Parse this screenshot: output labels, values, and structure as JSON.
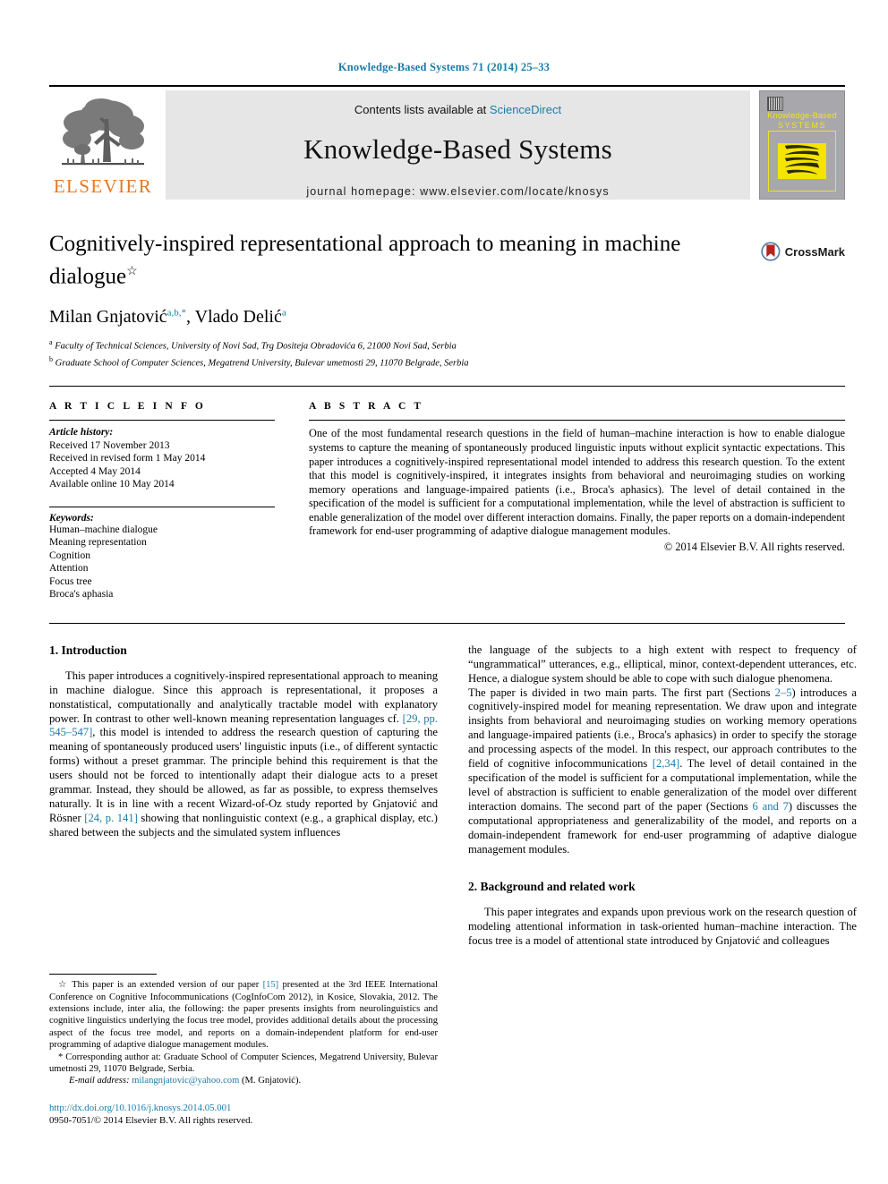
{
  "running_head": "Knowledge-Based Systems 71 (2014) 25–33",
  "masthead": {
    "contents_prefix": "Contents lists available at ",
    "sciencedirect": "ScienceDirect",
    "journal_name": "Knowledge-Based Systems",
    "homepage": "journal homepage: www.elsevier.com/locate/knosys",
    "publisher_wordmark": "ELSEVIER",
    "cover_title_line1": "Knowledge-Based",
    "cover_title_line2": "SYSTEMS",
    "accent_blue": "#1a7ba8",
    "elsevier_orange": "#E87722",
    "cover_yellow": "#f2e31a"
  },
  "article": {
    "title": "Cognitively-inspired representational approach to meaning in machine dialogue",
    "title_marker": "☆",
    "authors": "Milan Gnjatović, Vlado Delić",
    "author1_name": "Milan Gnjatović",
    "author1_sup": "a,b,*",
    "author2_name": "Vlado Delić",
    "author2_sup": "a",
    "affiliation_a": "Faculty of Technical Sciences, University of Novi Sad, Trg Dositeja Obradovića 6, 21000 Novi Sad, Serbia",
    "affiliation_b": "Graduate School of Computer Sciences, Megatrend University, Bulevar umetnosti 29, 11070 Belgrade, Serbia",
    "crossmark_label": "CrossMark"
  },
  "article_info": {
    "heading": "A R T I C L E  I N F O",
    "history_label": "Article history:",
    "history": [
      "Received 17 November 2013",
      "Received in revised form 1 May 2014",
      "Accepted 4 May 2014",
      "Available online 10 May 2014"
    ],
    "keywords_label": "Keywords:",
    "keywords": [
      "Human–machine dialogue",
      "Meaning representation",
      "Cognition",
      "Attention",
      "Focus tree",
      "Broca's aphasia"
    ]
  },
  "abstract": {
    "heading": "A B S T R A C T",
    "text": "One of the most fundamental research questions in the field of human–machine interaction is how to enable dialogue systems to capture the meaning of spontaneously produced linguistic inputs without explicit syntactic expectations. This paper introduces a cognitively-inspired representational model intended to address this research question. To the extent that this model is cognitively-inspired, it integrates insights from behavioral and neuroimaging studies on working memory operations and language-impaired patients (i.e., Broca's aphasics). The level of detail contained in the specification of the model is sufficient for a computational implementation, while the level of abstraction is sufficient to enable generalization of the model over different interaction domains. Finally, the paper reports on a domain-independent framework for end-user programming of adaptive dialogue management modules.",
    "copyright": "© 2014 Elsevier B.V. All rights reserved."
  },
  "body": {
    "section1_heading": "1. Introduction",
    "section1_p1_a": "This paper introduces a cognitively-inspired representational approach to meaning in machine dialogue. Since this approach is representational, it proposes a nonstatistical, computationally and analytically tractable model with explanatory power. In contrast to other well-known meaning representation languages cf. ",
    "section1_p1_ref1": "[29, pp. 545–547]",
    "section1_p1_b": ", this model is intended to address the research question of capturing the meaning of spontaneously produced users' linguistic inputs (i.e., of different syntactic forms) without a preset grammar. The principle behind this requirement is that the users should not be forced to intentionally adapt their dialogue acts to a preset grammar. Instead, they should be allowed, as far as possible, to express themselves naturally. It is in line with a recent Wizard-of-Oz study reported by Gnjatović and Rösner ",
    "section1_p1_ref2": "[24, p. 141]",
    "section1_p1_c": " showing that nonlinguistic context (e.g., a graphical display, etc.) shared between the subjects and the simulated system influences the language of the subjects to a high extent with respect to frequency of “ungrammatical” utterances, e.g., elliptical, minor, context-dependent utterances, etc. Hence, a dialogue system should be able to cope with such dialogue phenomena.",
    "section1_p2_a": "The paper is divided in two main parts. The first part (Sections ",
    "section1_p2_ref1": "2–5",
    "section1_p2_b": ") introduces a cognitively-inspired model for meaning representation. We draw upon and integrate insights from behavioral and neuroimaging studies on working memory operations and language-impaired patients (i.e., Broca's aphasics) in order to specify the storage and processing aspects of the model. In this respect, our approach contributes to the field of cognitive infocommunications ",
    "section1_p2_ref2": "[2,34]",
    "section1_p2_c": ". The level of detail contained in the specification of the model is sufficient for a computational implementation, while the level of abstraction is sufficient to enable generalization of the model over different interaction domains. The second part of the paper (Sections ",
    "section1_p2_ref3": "6 and 7",
    "section1_p2_d": ") discusses the computational appropriateness and generalizability of the model, and reports on a domain-independent framework for end-user programming of adaptive dialogue management modules.",
    "section2_heading": "2. Background and related work",
    "section2_p1": "This paper integrates and expands upon previous work on the research question of modeling attentional information in task-oriented human–machine interaction. The focus tree is a model of attentional state introduced by Gnjatović and colleagues"
  },
  "footnotes": {
    "star_marker": "☆",
    "star_a": " This paper is an extended version of our paper ",
    "star_ref": "[15]",
    "star_b": " presented at the 3rd IEEE International Conference on Cognitive Infocommunications (CogInfoCom 2012), in Kosice, Slovakia, 2012. The extensions include, inter alia, the following: the paper presents insights from neurolinguistics and cognitive linguistics underlying the focus tree model, provides additional details about the processing aspect of the focus tree model, and reports on a domain-independent platform for end-user programming of adaptive dialogue management modules.",
    "corresponding_marker": "*",
    "corresponding": " Corresponding author at: Graduate School of Computer Sciences, Megatrend University, Bulevar umetnosti 29, 11070 Belgrade, Serbia.",
    "email_label": "E-mail address:",
    "email": "milangnjatovic@yahoo.com",
    "email_suffix": " (M. Gnjatović).",
    "doi": "http://dx.doi.org/10.1016/j.knosys.2014.05.001",
    "issn_line": "0950-7051/© 2014 Elsevier B.V. All rights reserved."
  }
}
